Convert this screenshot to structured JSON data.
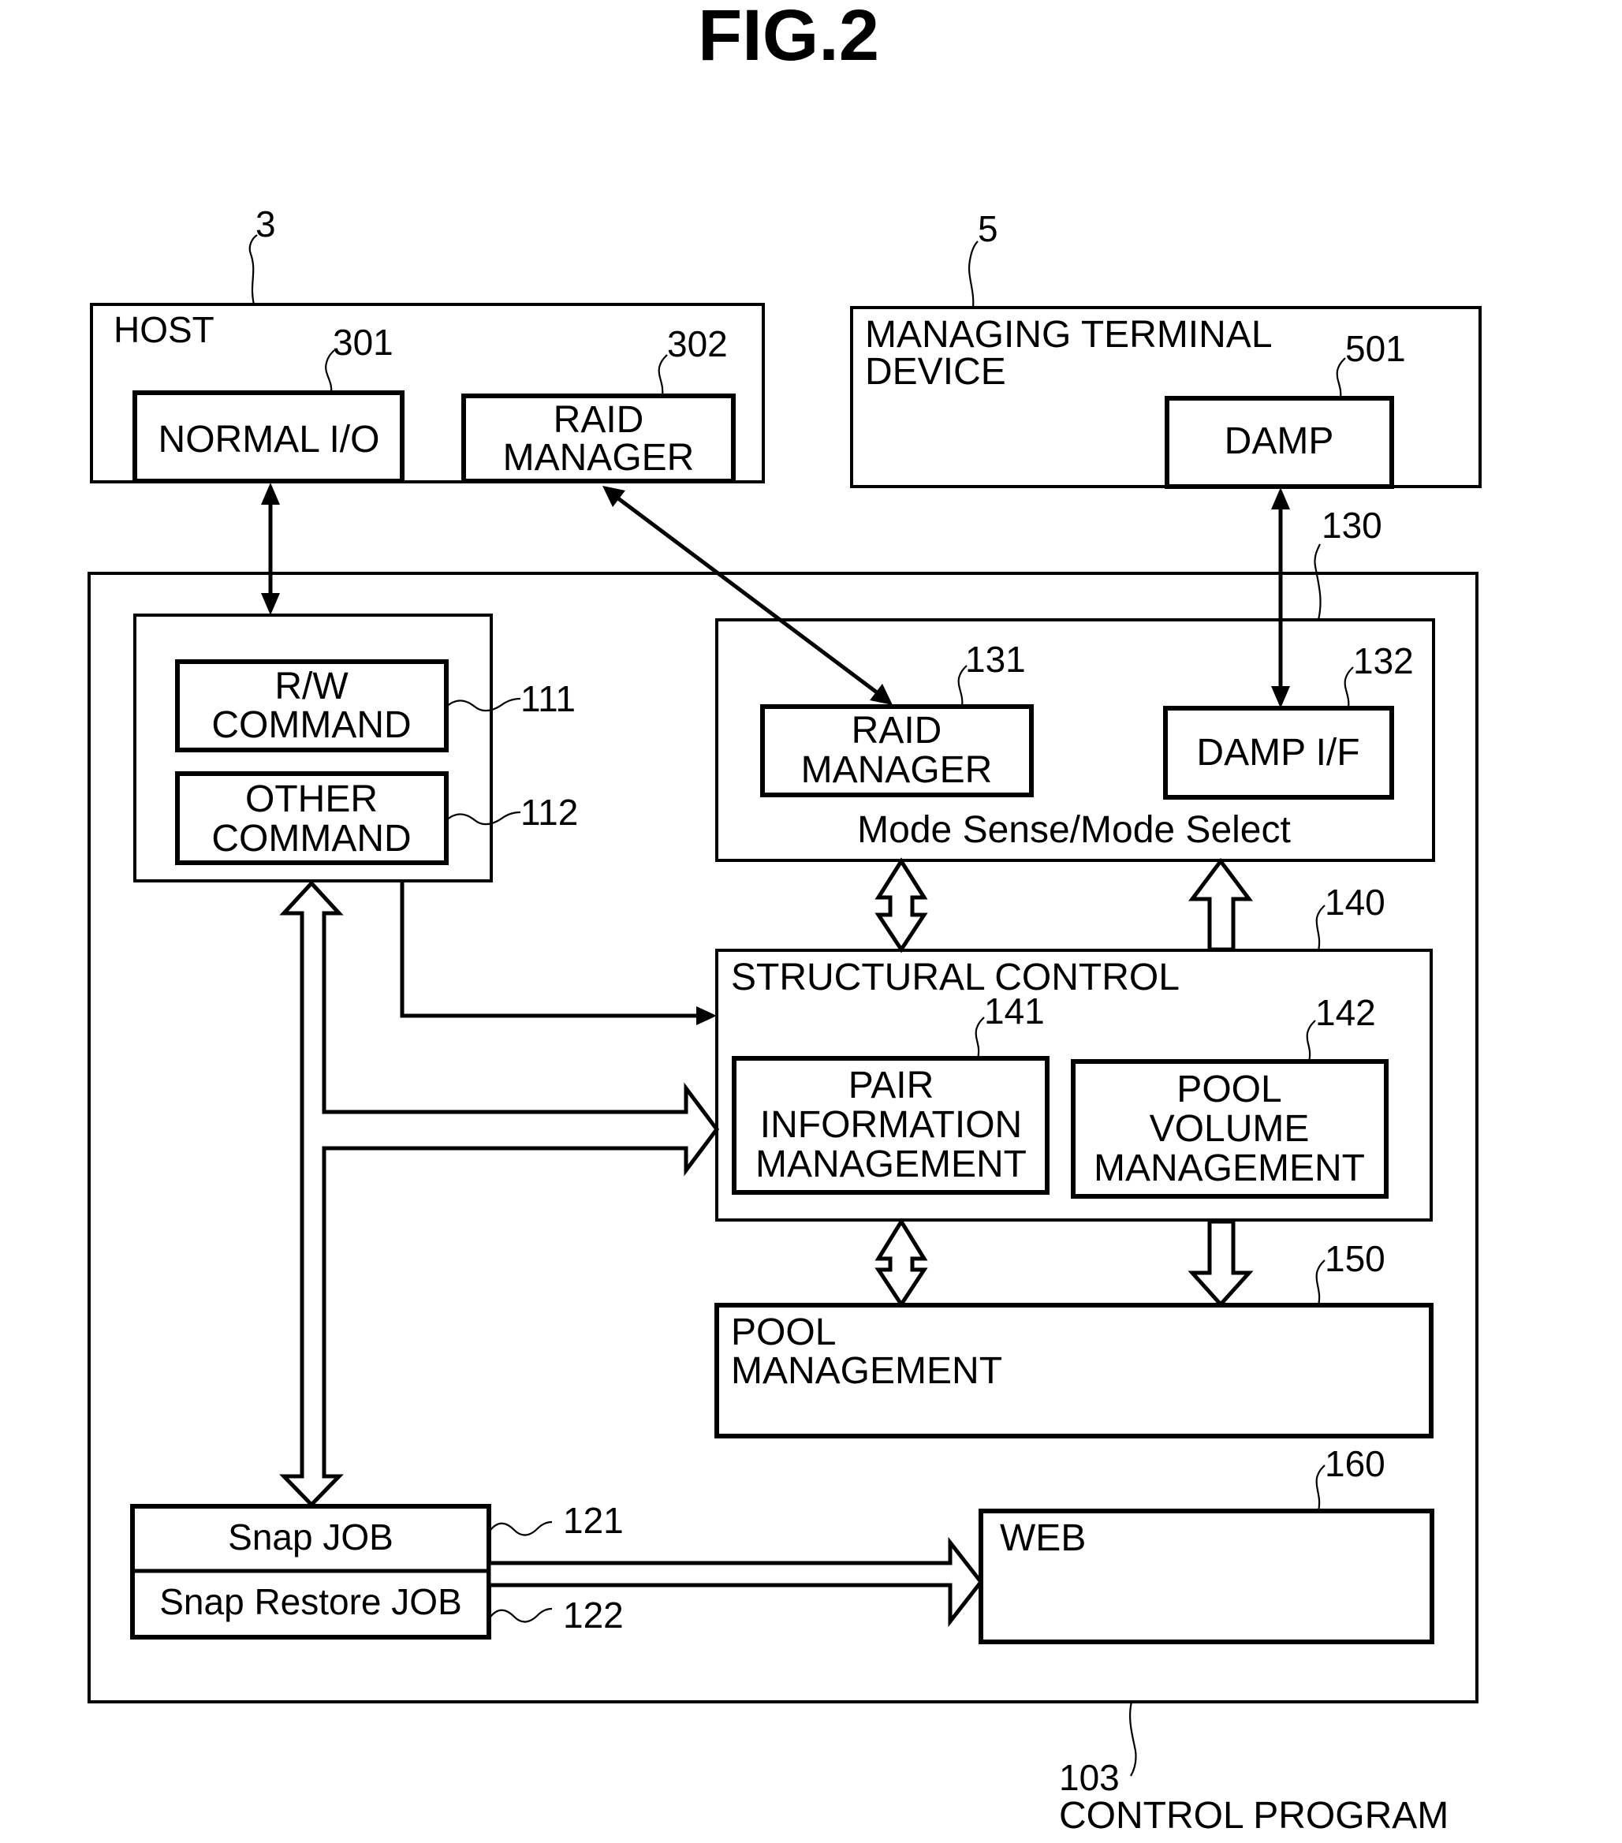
{
  "figure": {
    "title": "FIG.2"
  },
  "host": {
    "ref": "3",
    "label": "HOST",
    "normal_io": {
      "ref": "301",
      "label": "NORMAL I/O"
    },
    "raid_manager": {
      "ref": "302",
      "lines": [
        "RAID",
        "MANAGER"
      ]
    }
  },
  "managing_terminal": {
    "ref": "5",
    "lines": [
      "MANAGING TERMINAL",
      "DEVICE"
    ],
    "damp": {
      "ref": "501",
      "label": "DAMP"
    }
  },
  "control_program": {
    "ref": "103",
    "label": "CONTROL PROGRAM",
    "command_block": {
      "rw_command": {
        "ref": "111",
        "lines": [
          "R/W",
          "COMMAND"
        ]
      },
      "other_command": {
        "ref": "112",
        "lines": [
          "OTHER",
          "COMMAND"
        ]
      }
    },
    "interface_block": {
      "ref": "130",
      "footer": "Mode Sense/Mode Select",
      "raid_manager": {
        "ref": "131",
        "lines": [
          "RAID",
          "MANAGER"
        ]
      },
      "damp_if": {
        "ref": "132",
        "label": "DAMP I/F"
      }
    },
    "structural_control": {
      "ref": "140",
      "label": "STRUCTURAL CONTROL",
      "pair_info": {
        "ref": "141",
        "lines": [
          "PAIR",
          "INFORMATION",
          "MANAGEMENT"
        ]
      },
      "pool_volume": {
        "ref": "142",
        "lines": [
          "POOL",
          "VOLUME",
          "MANAGEMENT"
        ]
      }
    },
    "pool_management": {
      "ref": "150",
      "lines": [
        "POOL",
        "MANAGEMENT"
      ]
    },
    "web": {
      "ref": "160",
      "label": "WEB"
    },
    "snap_job": {
      "ref": "121",
      "label": "Snap JOB"
    },
    "snap_restore_job": {
      "ref": "122",
      "label": "Snap Restore JOB"
    }
  }
}
